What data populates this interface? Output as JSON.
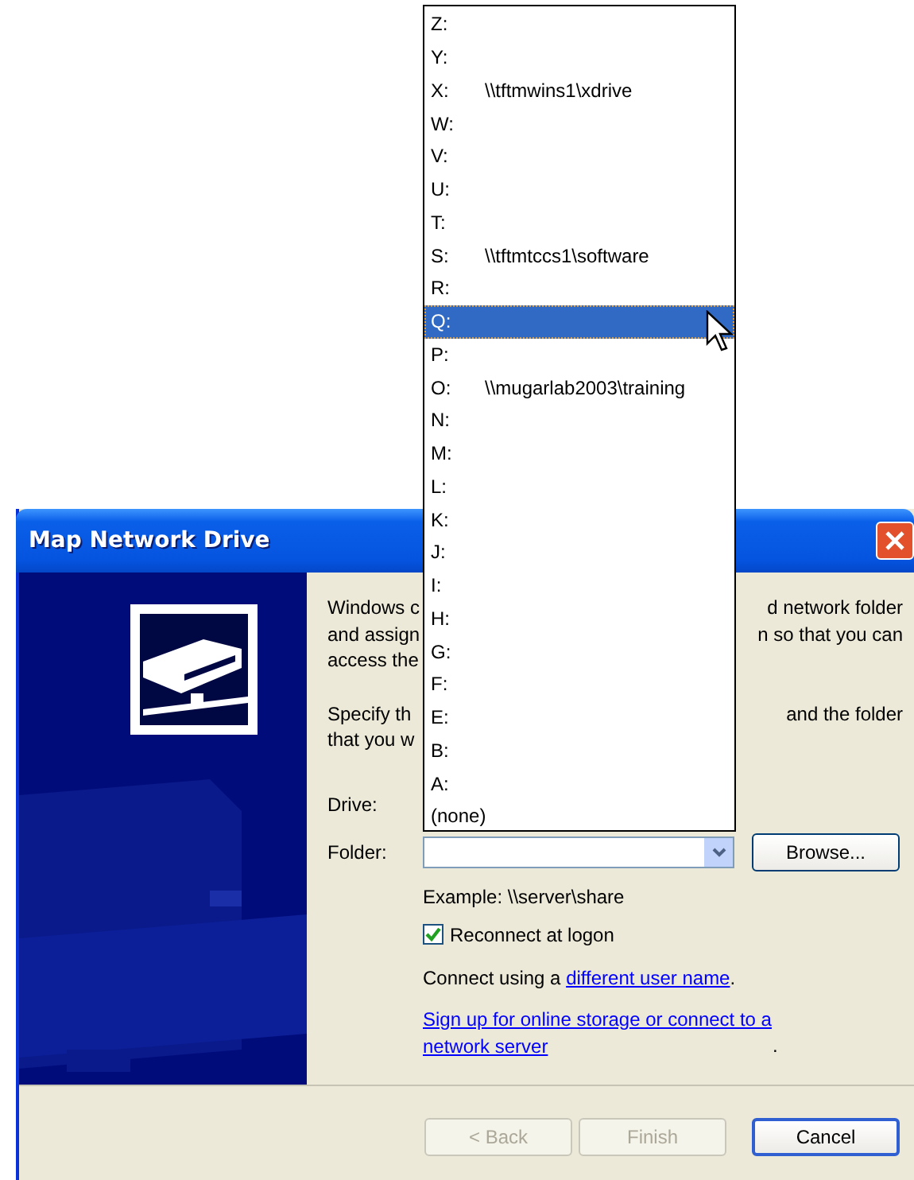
{
  "window": {
    "title": "Map Network Drive"
  },
  "paragraphs": [
    {
      "lines": [
        {
          "start": "Windows c",
          "end": "d network folder"
        },
        {
          "start": "and assign",
          "end": "n so that you can"
        },
        {
          "start": "access the"
        }
      ]
    },
    {
      "lines": [
        {
          "start": "Specify th",
          "end": "and the folder"
        },
        {
          "start": "that you w"
        }
      ]
    }
  ],
  "drive": {
    "label": "Drive:"
  },
  "folder": {
    "label": "Folder:"
  },
  "browse_button": "Browse...",
  "example": "Example: \\\\server\\share",
  "reconnect": {
    "label": "Reconnect at logon",
    "checked": true
  },
  "connect_using": {
    "text": "Connect using a ",
    "link": "different user name",
    "after": "."
  },
  "signup": {
    "link": "Sign up for online storage or connect to a network server",
    "after": "."
  },
  "buttons": [
    {
      "label": "< Back",
      "disabled": true,
      "focused": false
    },
    {
      "label": "Finish",
      "disabled": true,
      "focused": false
    },
    {
      "label": "Cancel",
      "disabled": false,
      "focused": true
    }
  ],
  "drive_list": {
    "items": [
      {
        "letter": "Z:",
        "selected": false
      },
      {
        "letter": "Y:",
        "selected": false
      },
      {
        "letter": "X:",
        "path": "\\\\tftmwins1\\xdrive",
        "selected": false
      },
      {
        "letter": "W:",
        "selected": false
      },
      {
        "letter": "V:",
        "selected": false
      },
      {
        "letter": "U:",
        "selected": false
      },
      {
        "letter": "T:",
        "selected": false
      },
      {
        "letter": "S:",
        "path": "\\\\tftmtccs1\\software",
        "selected": false
      },
      {
        "letter": "R:",
        "selected": false
      },
      {
        "letter": "Q:",
        "selected": true
      },
      {
        "letter": "P:",
        "selected": false
      },
      {
        "letter": "O:",
        "path": "\\\\mugarlab2003\\training",
        "selected": false
      },
      {
        "letter": "N:",
        "selected": false
      },
      {
        "letter": "M:",
        "selected": false
      },
      {
        "letter": "L:",
        "selected": false
      },
      {
        "letter": "K:",
        "selected": false
      },
      {
        "letter": "J:",
        "selected": false
      },
      {
        "letter": "I:",
        "selected": false
      },
      {
        "letter": "H:",
        "selected": false
      },
      {
        "letter": "G:",
        "selected": false
      },
      {
        "letter": "F:",
        "selected": false
      },
      {
        "letter": "E:",
        "selected": false
      },
      {
        "letter": "B:",
        "selected": false
      },
      {
        "letter": "A:",
        "selected": false
      },
      {
        "letter": "(none)",
        "selected": false
      }
    ]
  }
}
